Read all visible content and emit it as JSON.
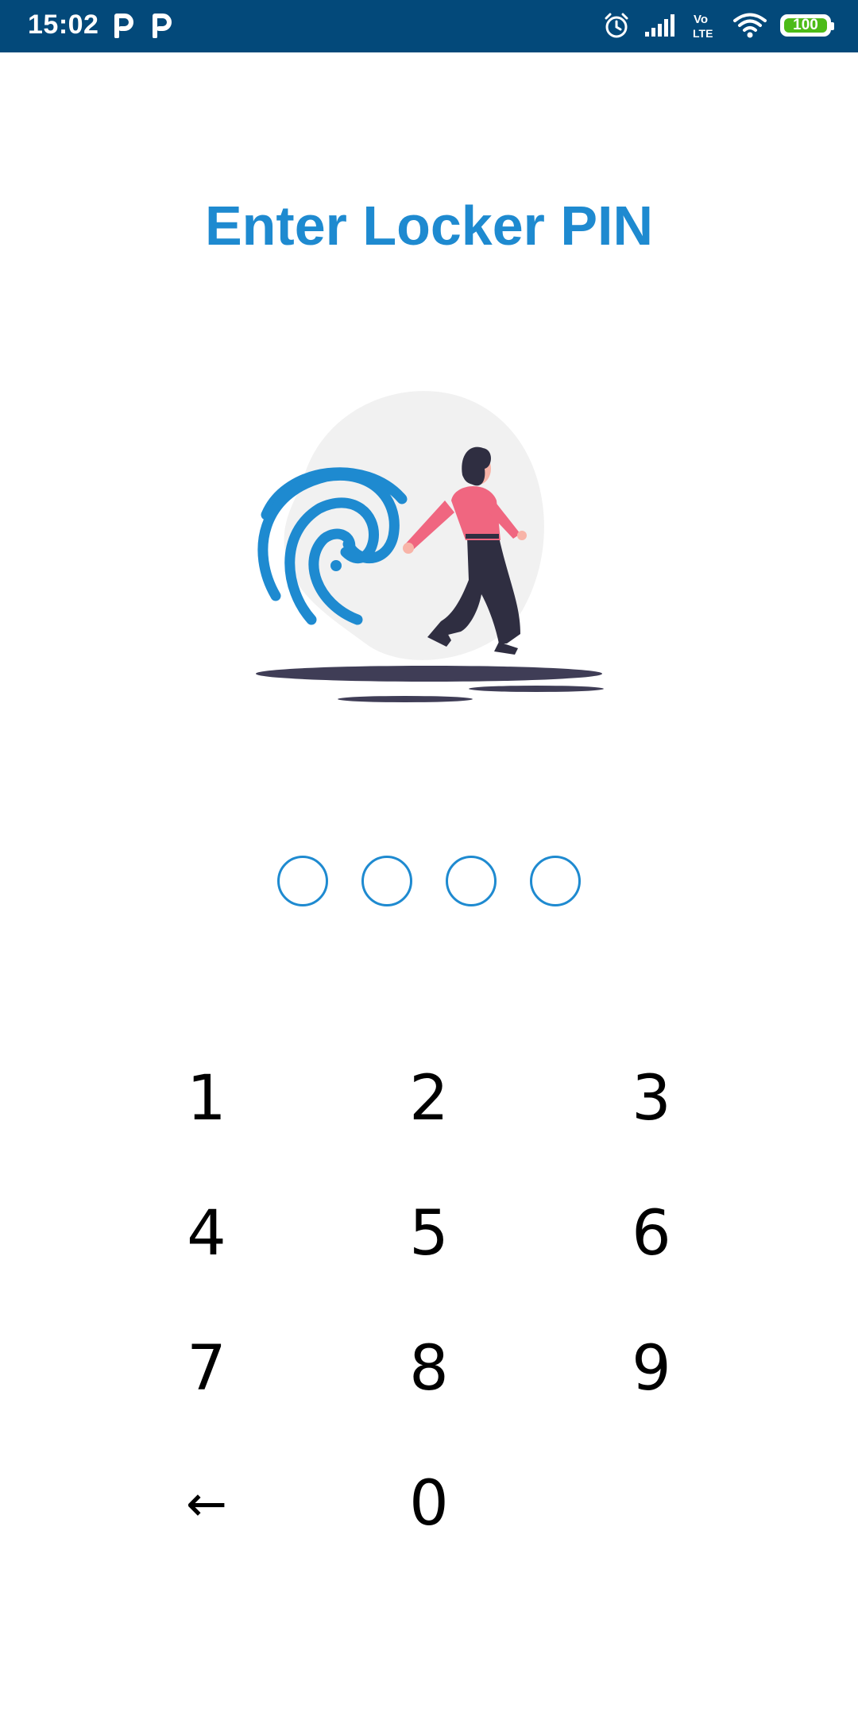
{
  "status_bar": {
    "time": "15:02",
    "notification_icons": [
      "p-notification-icon",
      "p-notification-icon"
    ],
    "right_icons": [
      "alarm-icon",
      "signal-icon",
      "volte-icon",
      "wifi-icon"
    ],
    "volte_top": "Vo",
    "volte_bottom": "LTE",
    "battery_level": "100",
    "colors": {
      "bar": "#03497a",
      "battery": "#4cbb17"
    }
  },
  "screen": {
    "title": "Enter Locker PIN",
    "accent_color": "#1e8ad0"
  },
  "illustration": {
    "icon": "fingerprint-woman-illustration"
  },
  "pin": {
    "length": 4,
    "filled": 0
  },
  "keypad": {
    "keys": [
      "1",
      "2",
      "3",
      "4",
      "5",
      "6",
      "7",
      "8",
      "9",
      "←",
      "0"
    ]
  }
}
